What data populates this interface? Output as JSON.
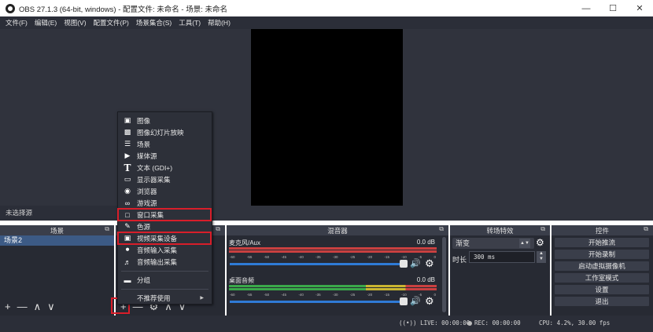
{
  "window": {
    "title": "OBS 27.1.3 (64-bit, windows) - 配置文件: 未命名 - 场景: 未命名",
    "minimize": "—",
    "maximize": "☐",
    "close": "✕"
  },
  "menubar": [
    "文件(F)",
    "编辑(E)",
    "视图(V)",
    "配置文件(P)",
    "场景集合(S)",
    "工具(T)",
    "帮助(H)"
  ],
  "no_source_label": "未选择源",
  "scenes": {
    "title": "场景",
    "items": [
      "场景2"
    ]
  },
  "sources": {
    "title": ""
  },
  "mixer": {
    "title": "混音器",
    "channels": [
      {
        "name": "麦克风/Aux",
        "db": "0.0 dB"
      },
      {
        "name": "桌面音频",
        "db": "0.0 dB"
      }
    ],
    "ticks": [
      "-60",
      "-55",
      "-50",
      "-45",
      "-40",
      "-35",
      "-30",
      "-25",
      "-20",
      "-15",
      "-10",
      "-5",
      "0"
    ]
  },
  "transitions": {
    "title": "转场特效",
    "selected": "渐变",
    "duration_label": "时长",
    "duration_value": "300 ms"
  },
  "controls": {
    "title": "控件",
    "buttons": [
      "开始推流",
      "开始录制",
      "启动虚拟摄像机",
      "工作室模式",
      "设置",
      "退出"
    ]
  },
  "toolbar_icons": {
    "add": "+",
    "remove": "—",
    "up": "∧",
    "down": "∨",
    "gear": "⚙"
  },
  "float_icon": "⧉",
  "status": {
    "live": "LIVE: 00:00:00",
    "rec": "REC: 00:00:00",
    "cpu": "CPU: 4.2%, 30.00 fps"
  },
  "context_menu": {
    "items": [
      {
        "label": "图像",
        "icon": "image-icon"
      },
      {
        "label": "图像幻灯片放映",
        "icon": "slideshow-icon"
      },
      {
        "label": "场景",
        "icon": "list-icon"
      },
      {
        "label": "媒体源",
        "icon": "play-icon"
      },
      {
        "label": "文本 (GDI+)",
        "icon": "text-icon"
      },
      {
        "label": "显示器采集",
        "icon": "monitor-icon"
      },
      {
        "label": "浏览器",
        "icon": "globe-icon"
      },
      {
        "label": "游戏源",
        "icon": "gamepad-icon"
      },
      {
        "label": "窗口采集",
        "icon": "window-icon"
      },
      {
        "label": "色源",
        "icon": "brush-icon"
      },
      {
        "label": "视频采集设备",
        "icon": "camera-icon"
      },
      {
        "label": "音频输入采集",
        "icon": "microphone-icon"
      },
      {
        "label": "音频输出采集",
        "icon": "speaker-icon"
      },
      {
        "label": "分组",
        "icon": "folder-icon"
      },
      {
        "label": "不推荐使用",
        "icon": ""
      }
    ]
  },
  "colors": {
    "accent": "#3c5a85",
    "highlight": "#d81e2a",
    "meter_green": "#3aa84a",
    "meter_yellow": "#c9b531",
    "meter_red": "#c94040"
  }
}
